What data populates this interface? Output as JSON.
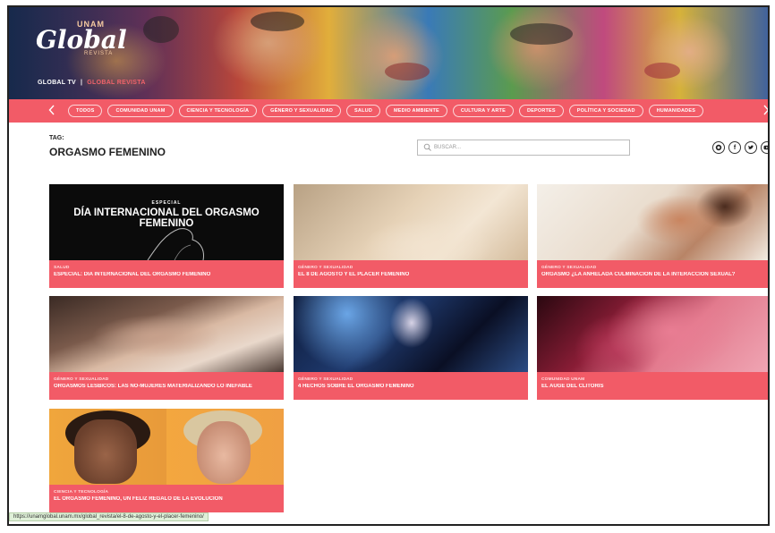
{
  "header": {
    "logo_unam": "UNAM",
    "logo_global": "Global",
    "logo_revista": "REVISTA",
    "tv_label": "GLOBAL TV",
    "separator": "|",
    "revista_label": "GLOBAL REVISTA"
  },
  "nav": {
    "prev_icon": "chevron-left-icon",
    "next_icon": "chevron-right-icon",
    "categories": [
      "TODOS",
      "COMUNIDAD UNAM",
      "CIENCIA Y TECNOLOGÍA",
      "GÉNERO Y SEXUALIDAD",
      "SALUD",
      "MEDIO AMBIENTE",
      "CULTURA Y ARTE",
      "DEPORTES",
      "POLÍTICA Y SOCIEDAD",
      "HUMANIDADES"
    ]
  },
  "tag": {
    "label": "TAG:",
    "title": "ORGASMO FEMENINO"
  },
  "search": {
    "placeholder": "BUSCAR..."
  },
  "social": [
    "whatsapp-icon",
    "facebook-icon",
    "twitter-icon",
    "youtube-icon"
  ],
  "cards": [
    {
      "category": "SALUD",
      "title": "ESPECIAL: DÍA INTERNACIONAL DEL ORGASMO FEMENINO",
      "image_kicker": "ESPECIAL",
      "image_heading": "DÍA INTERNACIONAL DEL ORGASMO FEMENINO"
    },
    {
      "category": "GÉNERO Y SEXUALIDAD",
      "title": "EL 8 DE AGOSTO Y EL PLACER FEMENINO"
    },
    {
      "category": "GÉNERO Y SEXUALIDAD",
      "title": "ORGASMO ¿LA ANHELADA CULMINACIÓN DE LA INTERACCIÓN SEXUAL?"
    },
    {
      "category": "GÉNERO Y SEXUALIDAD",
      "title": "ORGASMOS LÉSBICOS: LAS NO-MUJERES MATERIALIZANDO LO INEFABLE"
    },
    {
      "category": "GÉNERO Y SEXUALIDAD",
      "title": "4 HECHOS SOBRE EL ORGASMO FEMENINO"
    },
    {
      "category": "COMUNIDAD UNAM",
      "title": "EL AUGE DEL CLÍTORIS"
    },
    {
      "category": "CIENCIA Y TECNOLOGÍA",
      "title": "EL ORGASMO FEMENINO, UN FELIZ REGALO DE LA EVOLUCIÓN"
    }
  ],
  "statusbar": {
    "url": "https://unamglobal.unam.mx/global_revista/el-8-de-agosto-y-el-placer-femenino/"
  },
  "colors": {
    "accent": "#f25b67",
    "accent_text": "#f0626b"
  }
}
